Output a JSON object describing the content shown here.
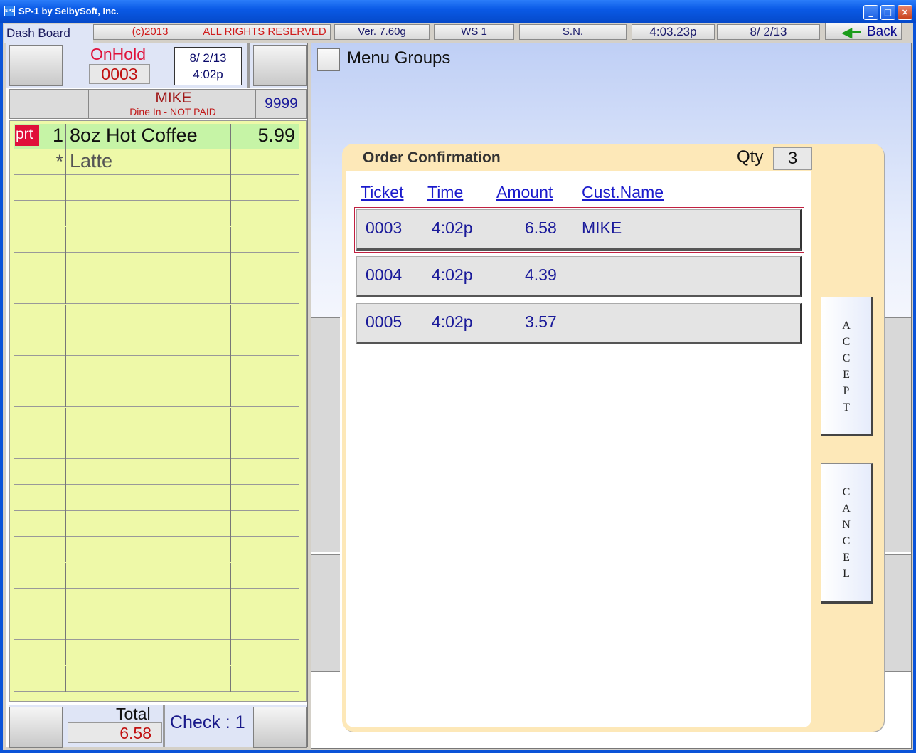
{
  "window": {
    "title": "SP-1 by SelbySoft, Inc.",
    "icon_text": "SP1",
    "controls": [
      "_",
      "□",
      "×"
    ]
  },
  "header": {
    "dash_board": "Dash Board",
    "copyright": "(c)2013",
    "rights": "ALL RIGHTS RESERVED",
    "version": "Ver. 7.60g",
    "workstation": "WS  1",
    "serial": "S.N.",
    "time": "4:03.23p",
    "date": "8/ 2/13",
    "back_label": "Back",
    "back_icon": "green-left-arrow-icon"
  },
  "ticket": {
    "status_label": "OnHold",
    "number": "0003",
    "date": "8/ 2/13",
    "time": "4:02p",
    "customer_name": "MIKE",
    "customer_status": "Dine In - NOT PAID",
    "customer_id": "9999",
    "items": [
      {
        "flag": "prt",
        "qty": "1",
        "name": "8oz Hot Coffee",
        "price": "5.99"
      },
      {
        "marker": "*",
        "name": "Latte"
      }
    ],
    "total_label": "Total",
    "total_value": "6.58",
    "check_label": "Check : 1"
  },
  "menu_groups": {
    "label": "Menu Groups"
  },
  "dialog": {
    "title": "Order Confirmation",
    "qty_label": "Qty",
    "qty_value": "3",
    "columns": [
      "Ticket",
      "Time",
      "Amount",
      "Cust.Name"
    ],
    "rows": [
      {
        "ticket": "0003",
        "time": "4:02p",
        "amount": "6.58",
        "name": "MIKE"
      },
      {
        "ticket": "0004",
        "time": "4:02p",
        "amount": "4.39",
        "name": ""
      },
      {
        "ticket": "0005",
        "time": "4:02p",
        "amount": "3.57",
        "name": ""
      }
    ],
    "accept_letters": [
      "A",
      "C",
      "C",
      "E",
      "P",
      "T"
    ],
    "cancel_letters": [
      "C",
      "A",
      "N",
      "C",
      "E",
      "L"
    ]
  }
}
